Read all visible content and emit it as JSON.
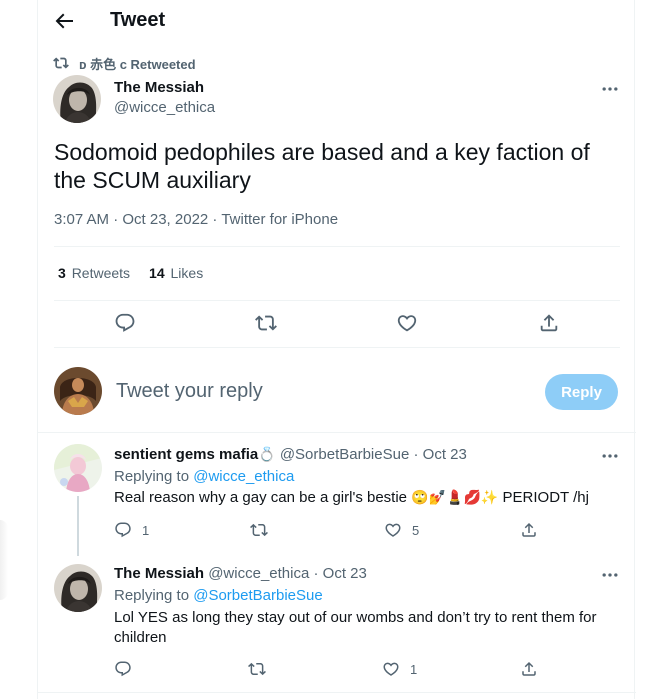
{
  "header": {
    "title": "Tweet"
  },
  "retweet_bar": {
    "text": "ᴅ 赤色 ᴄ Retweeted"
  },
  "main_tweet": {
    "author_name": "The Messiah",
    "author_handle": "@wicce_ethica",
    "text": "Sodomoid pedophiles are based and a key faction of the SCUM auxiliary",
    "meta": "3:07 AM · Oct 23, 2022 · Twitter for iPhone",
    "retweets_count": "3",
    "retweets_label": "Retweets",
    "likes_count": "14",
    "likes_label": "Likes"
  },
  "reply_box": {
    "placeholder": "Tweet your reply",
    "button_label": "Reply"
  },
  "replies": [
    {
      "author_name": "sentient gems mafia",
      "name_emoji": "💍",
      "author_handle": "@SorbetBarbieSue",
      "date": "· Oct 23",
      "replying_to_label": "Replying to",
      "replying_to_handle": "@wicce_ethica",
      "text": "Real reason why a gay can be a girl's bestie",
      "text_emojis": "🙄💅💄💋✨",
      "text_suffix": "PERIODT /hj",
      "reply_count": "1",
      "retweet_count": "",
      "like_count": "5"
    },
    {
      "author_name": "The Messiah",
      "author_handle": "@wicce_ethica",
      "date": "· Oct 23",
      "replying_to_label": "Replying to",
      "replying_to_handle": "@SorbetBarbieSue",
      "text": "Lol YES as long they stay out of our wombs and don’t try to rent them for children",
      "reply_count": "",
      "retweet_count": "",
      "like_count": "1"
    }
  ],
  "colors": {
    "accent": "#1d9bf0",
    "reply_button": "#8ecdf7",
    "secondary_text": "#536471",
    "border": "#eff3f4"
  }
}
